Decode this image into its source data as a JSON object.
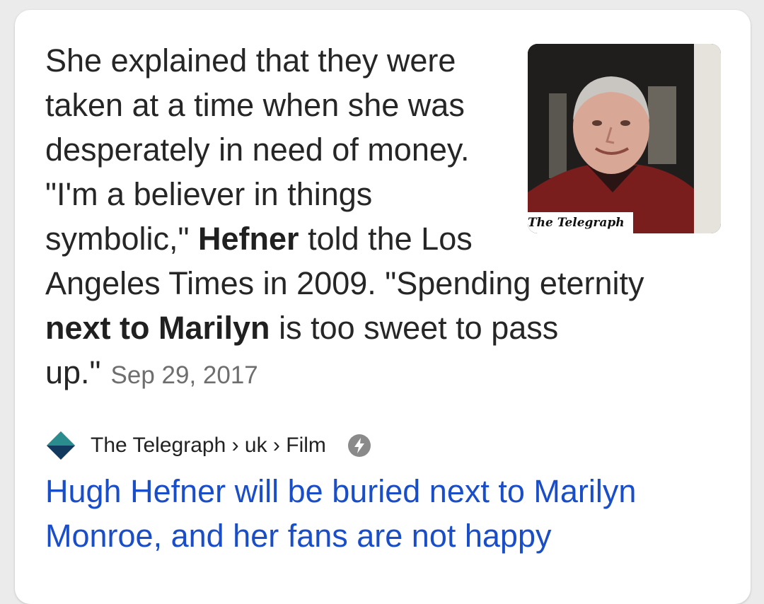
{
  "snippet": {
    "line1": "She explained that they were",
    "line2": "taken at a time when she was",
    "line3": "desperately in need of money.",
    "line4": "\"I'm a believer in things",
    "line5_a": "symbolic,\" ",
    "line5_bold": "Hefner",
    "line5_b": " told the Los",
    "line6": "Angeles Times in 2009. \"Spending eternity",
    "line7_bold": "next to Marilyn",
    "line7_b": " is too sweet to pass",
    "line8": "up.\"",
    "date": "Sep 29, 2017"
  },
  "thumbnail": {
    "caption": "The Telegraph",
    "icon": "portrait-photo"
  },
  "source": {
    "breadcrumb": "The Telegraph › uk › Film",
    "site_icon": "telegraph-diamond-logo",
    "amp_icon": "lightning-bolt-icon"
  },
  "result": {
    "title_line1": "Hugh Hefner will be buried next to Marilyn",
    "title_line2": "Monroe, and her fans are not happy"
  },
  "colors": {
    "link": "#1a4ec9",
    "text": "#262626",
    "date": "#6e6e6e",
    "logo_teal": "#2a8c8c",
    "logo_navy": "#123a5e"
  }
}
